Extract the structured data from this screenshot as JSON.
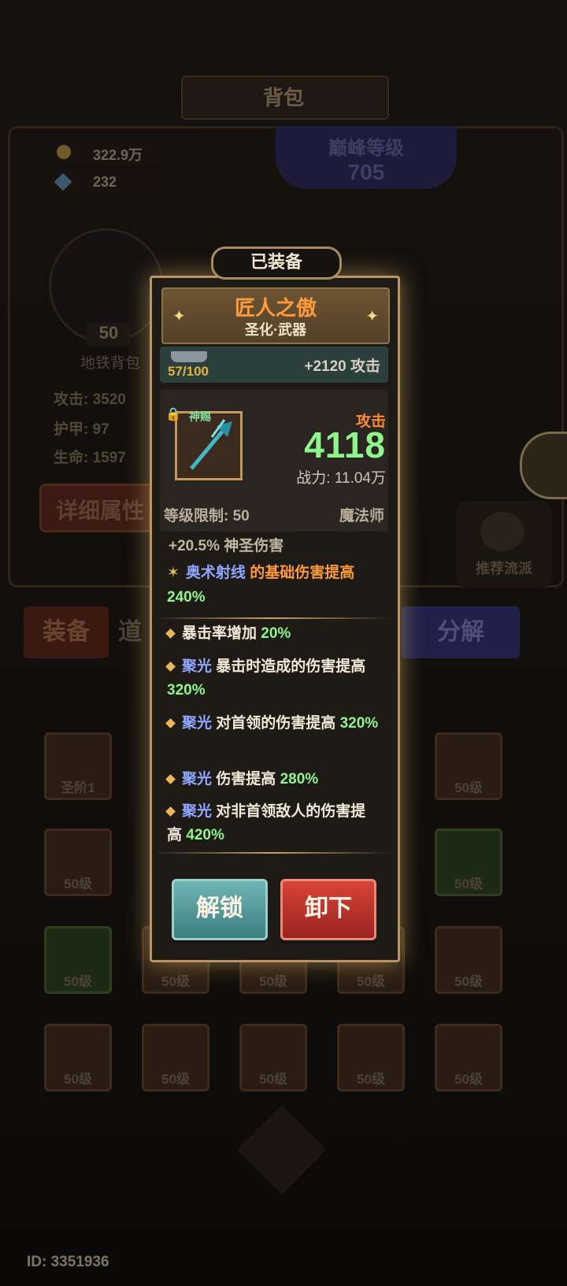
{
  "background": {
    "title": "背包",
    "gold": "322.9万",
    "gems": "232",
    "peak_label": "巅峰等级",
    "peak_value": "705",
    "player_level": "50",
    "bag_name": "地铁背包",
    "stats": [
      {
        "label": "攻击:",
        "value": "3520"
      },
      {
        "label": "护甲:",
        "value": "97"
      },
      {
        "label": "生命:",
        "value": "1597"
      }
    ],
    "detail_button": "详细属性",
    "recommend_button": "推荐流派",
    "tabs": [
      "装备",
      "道",
      "分解"
    ],
    "tile_level": "50级",
    "tile_rank": "圣阶1",
    "blessed_tag": "神赐",
    "id_text": "ID: 3351936"
  },
  "popup": {
    "tab": "已装备",
    "name": "匠人之傲",
    "type": "圣化·武器",
    "forge_progress": "57/100",
    "forge_bonus": "+2120 攻击",
    "blessed_tag": "神赐",
    "attack_label": "攻击",
    "attack_value": "4118",
    "power": "战力: 11.04万",
    "level_req": "等级限制: 50",
    "class": "魔法师",
    "partial_line": "+20.5% 神圣伤害",
    "special": {
      "skill": "奥术射线",
      "text": "的基础伤害提高",
      "value": "240%"
    },
    "affixes": [
      {
        "prefix": "",
        "text": "暴击率增加",
        "value": "20%"
      },
      {
        "prefix": "聚光",
        "text": "暴击时造成的伤害提高",
        "value": "320%"
      },
      {
        "prefix": "聚光",
        "text": "对首领的伤害提高",
        "value": "320%"
      },
      {
        "prefix": "聚光",
        "text": "伤害提高",
        "value": "280%"
      },
      {
        "prefix": "聚光",
        "text": "对非首领敌人的伤害提高",
        "value": "420%"
      }
    ],
    "unlock_button": "解锁",
    "unequip_button": "卸下"
  }
}
